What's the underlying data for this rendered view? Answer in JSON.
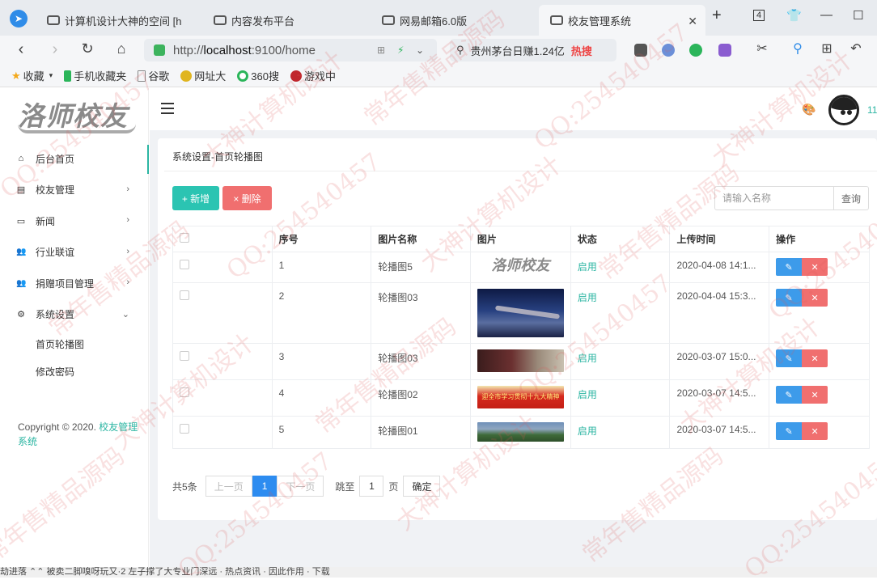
{
  "browser": {
    "tabs": [
      {
        "title": "计算机设计大神的空间 [h",
        "active": false
      },
      {
        "title": "内容发布平台",
        "active": false
      },
      {
        "title": "网易邮箱6.0版",
        "active": false
      },
      {
        "title": "校友管理系统",
        "active": true
      }
    ],
    "tab_count": "4",
    "url_prefix": "http://",
    "url_host": "localhost",
    "url_rest": ":9100/home",
    "search_text": "贵州茅台日赚1.24亿",
    "search_hot": "热搜",
    "bookmarks": [
      "收藏",
      "手机收藏夹",
      "谷歌",
      "网址大",
      "360搜",
      "游戏中"
    ],
    "statusbar_text": "劫进落  ⌃⌃  被卖二脚嗅呀玩又·2 左子撑了大专业门深远  ·  热点资讯  ·  因此作用  ·  下载"
  },
  "sidebar": {
    "logo_text": "洛师校友",
    "menu": [
      {
        "label": "后台首页",
        "icon": "home-icon",
        "glyph": "⌂",
        "has_arrow": false,
        "active": true
      },
      {
        "label": "校友管理",
        "icon": "card-icon",
        "glyph": "▤",
        "has_arrow": true,
        "arrow": "›"
      },
      {
        "label": "新闻",
        "icon": "news-icon",
        "glyph": "▭",
        "has_arrow": true,
        "arrow": "›"
      },
      {
        "label": "行业联谊",
        "icon": "group-icon",
        "glyph": "👥",
        "has_arrow": true,
        "arrow": "›"
      },
      {
        "label": "捐赠项目管理",
        "icon": "donate-icon",
        "glyph": "👥",
        "has_arrow": true,
        "arrow": "›"
      },
      {
        "label": "系统设置",
        "icon": "gear-icon",
        "glyph": "⚙",
        "has_arrow": true,
        "arrow": "⌄"
      }
    ],
    "submenu": [
      "首页轮播图",
      "修改密码"
    ],
    "copyright_prefix": "Copyright © 2020. ",
    "copyright_link": "校友管理系统"
  },
  "header": {
    "username": "11"
  },
  "content": {
    "breadcrumb": "系统设置-首页轮播图",
    "add_label": "+ 新增",
    "delete_label": "× 删除",
    "search_placeholder": "请输入名称",
    "search_button": "查询",
    "columns": [
      "",
      "序号",
      "图片名称",
      "图片",
      "状态",
      "上传时间",
      "操作"
    ],
    "rows": [
      {
        "no": "1",
        "name": "轮播图5",
        "image": "logo",
        "status": "启用",
        "time": "2020-04-08 14:1..."
      },
      {
        "no": "2",
        "name": "轮播图03",
        "image": "plane",
        "status": "启用",
        "time": "2020-04-04 15:3..."
      },
      {
        "no": "3",
        "name": "轮播图03",
        "image": "red1",
        "status": "启用",
        "time": "2020-03-07 15:0..."
      },
      {
        "no": "4",
        "name": "轮播图02",
        "image": "red2",
        "status": "启用",
        "time": "2020-03-07 14:5..."
      },
      {
        "no": "5",
        "name": "轮播图01",
        "image": "campus",
        "status": "启用",
        "time": "2020-03-07 14:5..."
      }
    ],
    "row_heights": [
      38,
      75,
      45,
      45,
      40
    ],
    "edit_icon": "✎",
    "delete_icon": "✕",
    "image_labels": {
      "logo": "洛师校友",
      "red2": "迎全市学习贯彻十九大精神"
    }
  },
  "pager": {
    "total": "共5条",
    "prev": "上一页",
    "current": "1",
    "next": "下一页",
    "goto": "跳至",
    "page_value": "1",
    "page_unit": "页",
    "confirm": "确定"
  },
  "watermarks": [
    "QQ:254540457",
    "大神计算机设计",
    "常年售精品源码"
  ],
  "colors": {
    "accent": "#2bb5a2",
    "danger": "#f06f6f",
    "primary": "#3d9bea"
  }
}
